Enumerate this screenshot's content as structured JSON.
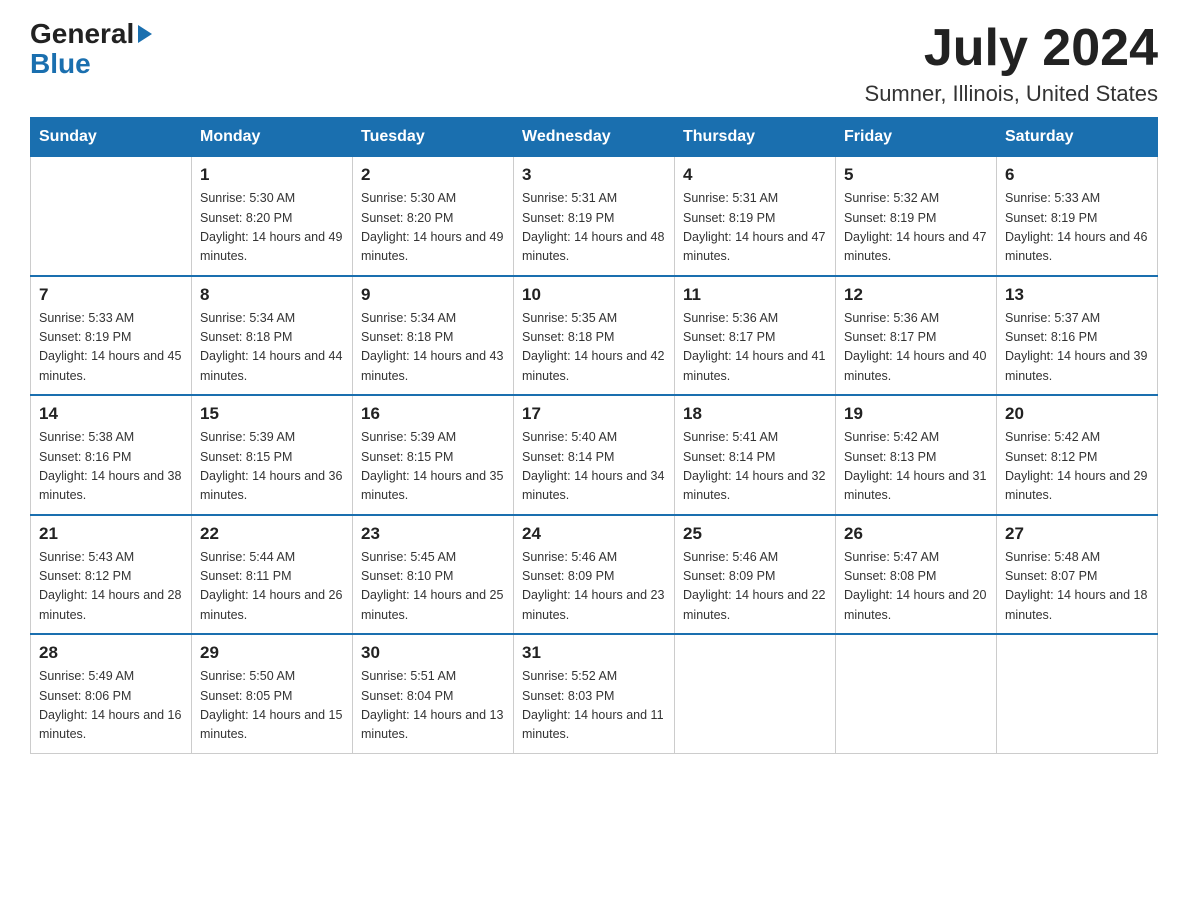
{
  "logo": {
    "general": "General",
    "blue": "Blue"
  },
  "title": "July 2024",
  "location": "Sumner, Illinois, United States",
  "days_of_week": [
    "Sunday",
    "Monday",
    "Tuesday",
    "Wednesday",
    "Thursday",
    "Friday",
    "Saturday"
  ],
  "weeks": [
    [
      {
        "day": "",
        "sunrise": "",
        "sunset": "",
        "daylight": ""
      },
      {
        "day": "1",
        "sunrise": "Sunrise: 5:30 AM",
        "sunset": "Sunset: 8:20 PM",
        "daylight": "Daylight: 14 hours and 49 minutes."
      },
      {
        "day": "2",
        "sunrise": "Sunrise: 5:30 AM",
        "sunset": "Sunset: 8:20 PM",
        "daylight": "Daylight: 14 hours and 49 minutes."
      },
      {
        "day": "3",
        "sunrise": "Sunrise: 5:31 AM",
        "sunset": "Sunset: 8:19 PM",
        "daylight": "Daylight: 14 hours and 48 minutes."
      },
      {
        "day": "4",
        "sunrise": "Sunrise: 5:31 AM",
        "sunset": "Sunset: 8:19 PM",
        "daylight": "Daylight: 14 hours and 47 minutes."
      },
      {
        "day": "5",
        "sunrise": "Sunrise: 5:32 AM",
        "sunset": "Sunset: 8:19 PM",
        "daylight": "Daylight: 14 hours and 47 minutes."
      },
      {
        "day": "6",
        "sunrise": "Sunrise: 5:33 AM",
        "sunset": "Sunset: 8:19 PM",
        "daylight": "Daylight: 14 hours and 46 minutes."
      }
    ],
    [
      {
        "day": "7",
        "sunrise": "Sunrise: 5:33 AM",
        "sunset": "Sunset: 8:19 PM",
        "daylight": "Daylight: 14 hours and 45 minutes."
      },
      {
        "day": "8",
        "sunrise": "Sunrise: 5:34 AM",
        "sunset": "Sunset: 8:18 PM",
        "daylight": "Daylight: 14 hours and 44 minutes."
      },
      {
        "day": "9",
        "sunrise": "Sunrise: 5:34 AM",
        "sunset": "Sunset: 8:18 PM",
        "daylight": "Daylight: 14 hours and 43 minutes."
      },
      {
        "day": "10",
        "sunrise": "Sunrise: 5:35 AM",
        "sunset": "Sunset: 8:18 PM",
        "daylight": "Daylight: 14 hours and 42 minutes."
      },
      {
        "day": "11",
        "sunrise": "Sunrise: 5:36 AM",
        "sunset": "Sunset: 8:17 PM",
        "daylight": "Daylight: 14 hours and 41 minutes."
      },
      {
        "day": "12",
        "sunrise": "Sunrise: 5:36 AM",
        "sunset": "Sunset: 8:17 PM",
        "daylight": "Daylight: 14 hours and 40 minutes."
      },
      {
        "day": "13",
        "sunrise": "Sunrise: 5:37 AM",
        "sunset": "Sunset: 8:16 PM",
        "daylight": "Daylight: 14 hours and 39 minutes."
      }
    ],
    [
      {
        "day": "14",
        "sunrise": "Sunrise: 5:38 AM",
        "sunset": "Sunset: 8:16 PM",
        "daylight": "Daylight: 14 hours and 38 minutes."
      },
      {
        "day": "15",
        "sunrise": "Sunrise: 5:39 AM",
        "sunset": "Sunset: 8:15 PM",
        "daylight": "Daylight: 14 hours and 36 minutes."
      },
      {
        "day": "16",
        "sunrise": "Sunrise: 5:39 AM",
        "sunset": "Sunset: 8:15 PM",
        "daylight": "Daylight: 14 hours and 35 minutes."
      },
      {
        "day": "17",
        "sunrise": "Sunrise: 5:40 AM",
        "sunset": "Sunset: 8:14 PM",
        "daylight": "Daylight: 14 hours and 34 minutes."
      },
      {
        "day": "18",
        "sunrise": "Sunrise: 5:41 AM",
        "sunset": "Sunset: 8:14 PM",
        "daylight": "Daylight: 14 hours and 32 minutes."
      },
      {
        "day": "19",
        "sunrise": "Sunrise: 5:42 AM",
        "sunset": "Sunset: 8:13 PM",
        "daylight": "Daylight: 14 hours and 31 minutes."
      },
      {
        "day": "20",
        "sunrise": "Sunrise: 5:42 AM",
        "sunset": "Sunset: 8:12 PM",
        "daylight": "Daylight: 14 hours and 29 minutes."
      }
    ],
    [
      {
        "day": "21",
        "sunrise": "Sunrise: 5:43 AM",
        "sunset": "Sunset: 8:12 PM",
        "daylight": "Daylight: 14 hours and 28 minutes."
      },
      {
        "day": "22",
        "sunrise": "Sunrise: 5:44 AM",
        "sunset": "Sunset: 8:11 PM",
        "daylight": "Daylight: 14 hours and 26 minutes."
      },
      {
        "day": "23",
        "sunrise": "Sunrise: 5:45 AM",
        "sunset": "Sunset: 8:10 PM",
        "daylight": "Daylight: 14 hours and 25 minutes."
      },
      {
        "day": "24",
        "sunrise": "Sunrise: 5:46 AM",
        "sunset": "Sunset: 8:09 PM",
        "daylight": "Daylight: 14 hours and 23 minutes."
      },
      {
        "day": "25",
        "sunrise": "Sunrise: 5:46 AM",
        "sunset": "Sunset: 8:09 PM",
        "daylight": "Daylight: 14 hours and 22 minutes."
      },
      {
        "day": "26",
        "sunrise": "Sunrise: 5:47 AM",
        "sunset": "Sunset: 8:08 PM",
        "daylight": "Daylight: 14 hours and 20 minutes."
      },
      {
        "day": "27",
        "sunrise": "Sunrise: 5:48 AM",
        "sunset": "Sunset: 8:07 PM",
        "daylight": "Daylight: 14 hours and 18 minutes."
      }
    ],
    [
      {
        "day": "28",
        "sunrise": "Sunrise: 5:49 AM",
        "sunset": "Sunset: 8:06 PM",
        "daylight": "Daylight: 14 hours and 16 minutes."
      },
      {
        "day": "29",
        "sunrise": "Sunrise: 5:50 AM",
        "sunset": "Sunset: 8:05 PM",
        "daylight": "Daylight: 14 hours and 15 minutes."
      },
      {
        "day": "30",
        "sunrise": "Sunrise: 5:51 AM",
        "sunset": "Sunset: 8:04 PM",
        "daylight": "Daylight: 14 hours and 13 minutes."
      },
      {
        "day": "31",
        "sunrise": "Sunrise: 5:52 AM",
        "sunset": "Sunset: 8:03 PM",
        "daylight": "Daylight: 14 hours and 11 minutes."
      },
      {
        "day": "",
        "sunrise": "",
        "sunset": "",
        "daylight": ""
      },
      {
        "day": "",
        "sunrise": "",
        "sunset": "",
        "daylight": ""
      },
      {
        "day": "",
        "sunrise": "",
        "sunset": "",
        "daylight": ""
      }
    ]
  ]
}
